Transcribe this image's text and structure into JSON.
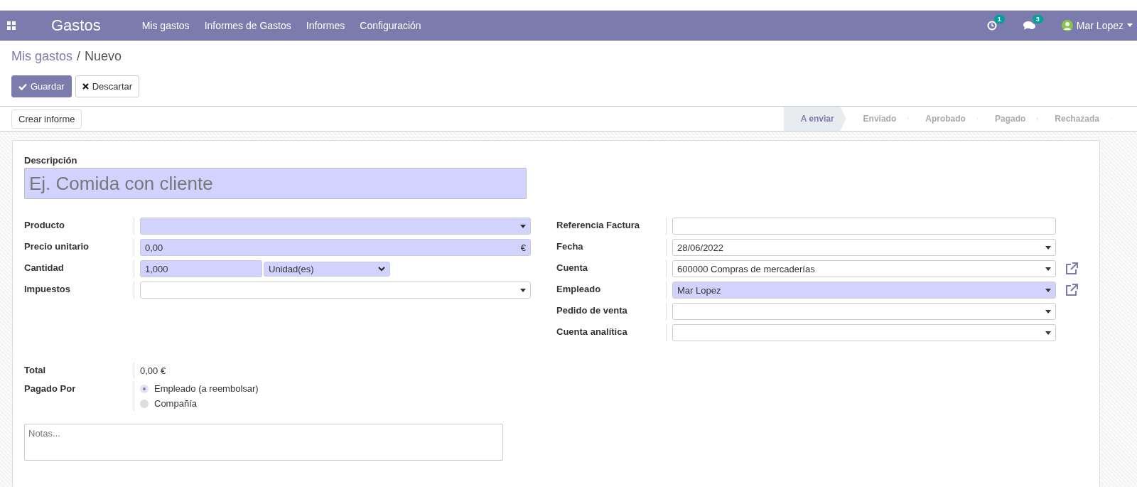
{
  "navbar": {
    "app": "Gastos",
    "menu": [
      "Mis gastos",
      "Informes de Gastos",
      "Informes",
      "Configuración"
    ],
    "activities_count": "1",
    "messages_count": "3",
    "user": "Mar Lopez"
  },
  "breadcrumb": {
    "parent": "Mis gastos",
    "separator": "/",
    "current": "Nuevo"
  },
  "buttons": [
    {
      "kind": "primary",
      "label": "Guardar"
    },
    {
      "kind": "secondary",
      "label": "Descartar"
    }
  ],
  "status_bar": {
    "action": "Crear informe",
    "stages": [
      {
        "label": "A enviar",
        "selected": true
      },
      {
        "label": "Enviado",
        "selected": false
      },
      {
        "label": "Aprobado",
        "selected": false
      },
      {
        "label": "Pagado",
        "selected": false
      },
      {
        "label": "Rechazada",
        "selected": false
      }
    ]
  },
  "form": {
    "description_label": "Descripción",
    "description_placeholder": "Ej. Comida con cliente",
    "left_fields": [
      {
        "label": "Producto",
        "kind": "select",
        "required": true
      },
      {
        "label": "Precio unitario",
        "kind": "money",
        "required": true,
        "value": "0,00",
        "currency": "€"
      },
      {
        "label": "Cantidad",
        "kind": "quantity",
        "required": true,
        "value": "1,000",
        "unit": "Unidad(es)"
      },
      {
        "label": "Impuestos",
        "kind": "select",
        "required": false
      }
    ],
    "right_fields": [
      {
        "label": "Referencia Factura",
        "kind": "text",
        "required": false,
        "external_link": false
      },
      {
        "label": "Fecha",
        "kind": "select",
        "required": false,
        "value": "28/06/2022",
        "external_link": false
      },
      {
        "label": "Cuenta",
        "kind": "select",
        "required": false,
        "value": "600000 Compras de mercaderías",
        "external_link": true
      },
      {
        "label": "Empleado",
        "kind": "select",
        "required": true,
        "value": "Mar Lopez",
        "external_link": true
      },
      {
        "label": "Pedido de venta",
        "kind": "select",
        "required": false,
        "external_link": false
      },
      {
        "label": "Cuenta analítica",
        "kind": "select",
        "required": false,
        "external_link": false
      }
    ],
    "total_label": "Total",
    "total_value": "0,00 €",
    "paid_by_label": "Pagado Por",
    "paid_by_options": [
      {
        "label": "Empleado (a reembolsar)",
        "selected": true
      },
      {
        "label": "Compañía",
        "selected": false
      }
    ],
    "notes_placeholder": "Notas..."
  }
}
